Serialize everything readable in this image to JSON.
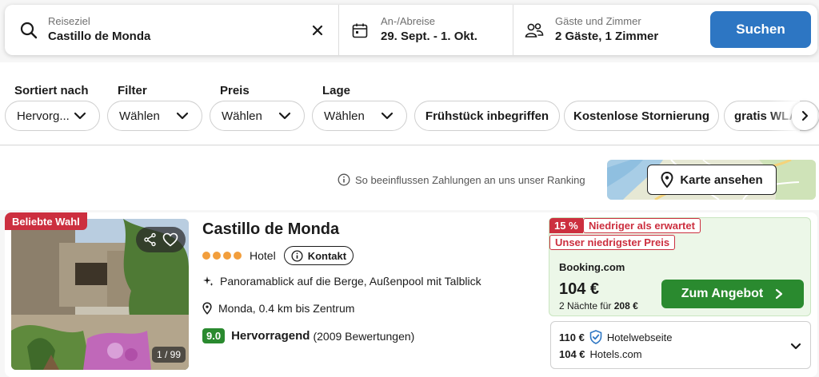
{
  "search": {
    "destination_label": "Reiseziel",
    "destination_value": "Castillo de Monda",
    "dates_label": "An-/Abreise",
    "dates_value": "29. Sept. - 1. Okt.",
    "guests_label": "Gäste und Zimmer",
    "guests_value": "2 Gäste, 1 Zimmer",
    "search_button": "Suchen"
  },
  "filters": {
    "groups": [
      {
        "label": "Sortiert nach",
        "value": "Hervorg..."
      },
      {
        "label": "Filter",
        "value": "Wählen"
      },
      {
        "label": "Preis",
        "value": "Wählen"
      },
      {
        "label": "Lage",
        "value": "Wählen"
      }
    ],
    "quick": [
      "Frühstück inbegriffen",
      "Kostenlose Stornierung",
      "gratis WLAN"
    ]
  },
  "info": {
    "ranking_text": "So beeinflussen Zahlungen an uns unser Ranking",
    "map_button": "Karte ansehen"
  },
  "hotel": {
    "badge": "Beliebte Wahl",
    "photo_count": "1 / 99",
    "name": "Castillo de Monda",
    "stars": 4,
    "type": "Hotel",
    "contact_label": "Kontakt",
    "feature": "Panoramablick auf die Berge, Außenpool mit Talblick",
    "location": "Monda, 0.4 km bis Zentrum",
    "score": "9.0",
    "rating_word": "Hervorragend",
    "reviews": "(2009 Bewertungen)"
  },
  "deal": {
    "percent": "15 %",
    "tag1": "Niedriger als erwartet",
    "tag2": "Unser niedrigster Preis",
    "provider": "Booking.com",
    "price": "104 €",
    "nights_prefix": "2 Nächte für",
    "nights_total": "208 €",
    "button": "Zum Angebot"
  },
  "other_offers": [
    {
      "price": "110 €",
      "provider": "Hotelwebseite"
    },
    {
      "price": "104 €",
      "provider": "Hotels.com"
    }
  ],
  "colors": {
    "primary_blue": "#2d76c3",
    "deal_green": "#2a8a2f",
    "badge_red": "#cc2f3f",
    "star_orange": "#f29e3c"
  }
}
